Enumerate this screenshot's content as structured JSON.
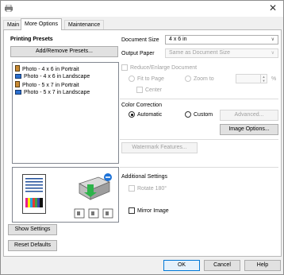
{
  "window": {
    "close_glyph": "✕"
  },
  "tabs": [
    {
      "label": "Main"
    },
    {
      "label": "More Options"
    },
    {
      "label": "Maintenance"
    }
  ],
  "presets": {
    "heading": "Printing Presets",
    "add_remove_label": "Add/Remove Presets...",
    "items": [
      {
        "label": "Photo - 4 x 6 in Portrait",
        "icon": "portrait-photo-icon",
        "color": "#d08a2a"
      },
      {
        "label": "Photo - 4 x 6 in Landscape",
        "icon": "landscape-photo-icon",
        "color": "#2a6fd0"
      },
      {
        "label": "Photo - 5 x 7 in Portrait",
        "icon": "portrait-photo-icon",
        "color": "#d08a2a"
      },
      {
        "label": "Photo - 5 x 7 in Landscape",
        "icon": "landscape-photo-icon",
        "color": "#2a6fd0"
      }
    ]
  },
  "left_buttons": {
    "show_settings": "Show Settings",
    "reset_defaults": "Reset Defaults"
  },
  "document_size": {
    "label": "Document Size",
    "value": "4 x 6 in"
  },
  "output_paper": {
    "label": "Output Paper",
    "value": "Same as Document Size"
  },
  "reduce_enlarge": {
    "label": "Reduce/Enlarge Document",
    "fit_to_page": "Fit to Page",
    "zoom_to": "Zoom to",
    "center": "Center",
    "percent": "%"
  },
  "color_correction": {
    "label": "Color Correction",
    "automatic": "Automatic",
    "custom": "Custom",
    "advanced": "Advanced...",
    "image_options": "Image Options..."
  },
  "watermark": {
    "label": "Watermark Features..."
  },
  "additional": {
    "label": "Additional Settings",
    "rotate": "Rotate 180°",
    "mirror": "Mirror Image"
  },
  "footer": {
    "ok": "OK",
    "cancel": "Cancel",
    "help": "Help"
  },
  "colors": {
    "accent": "#0078d7",
    "disabled_text": "#a0a0a0"
  }
}
